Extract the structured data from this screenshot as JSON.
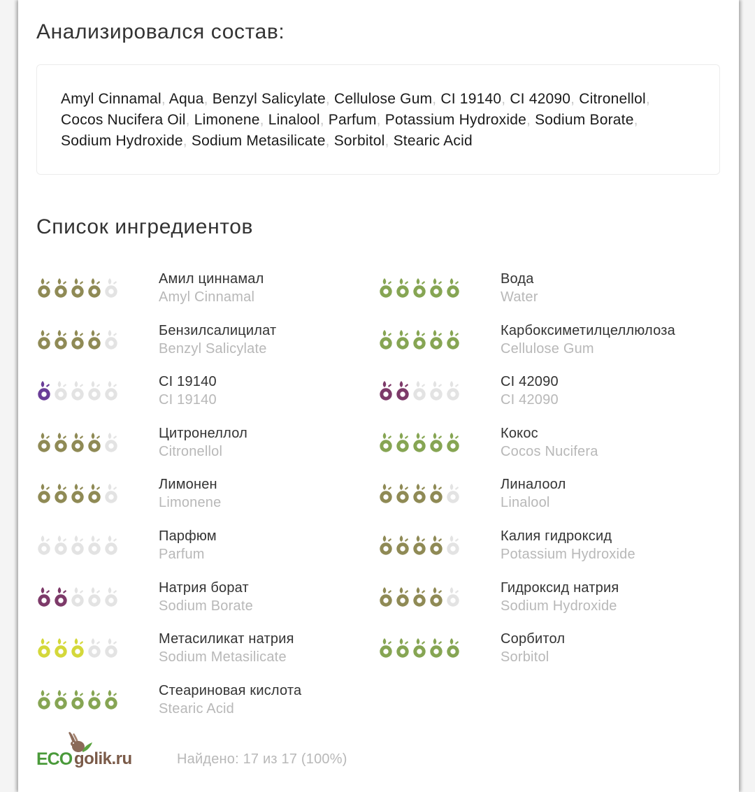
{
  "composition": {
    "title": "Анализировался состав:",
    "ingredients": [
      "Amyl Cinnamal",
      "Aqua",
      "Benzyl Salicylate",
      "Cellulose Gum",
      "CI 19140",
      "CI 42090",
      "Citronellol",
      "Cocos Nucifera Oil",
      "Limonene",
      "Linalool",
      "Parfum",
      "Potassium Hydroxide",
      "Sodium Borate",
      "Sodium Hydroxide",
      "Sodium Metasilicate",
      "Sorbitol",
      "Stearic Acid"
    ],
    "separator": ","
  },
  "ingredient_list": {
    "title": "Список ингредиентов",
    "colors": {
      "olive": "#8f8a55",
      "green": "#86a553",
      "purple": "#6a3d98",
      "plum": "#7d3a69",
      "yellow": "#d4d83a",
      "empty": "#e3e3e3"
    },
    "items": [
      {
        "name": "Амил циннамал",
        "latin": "Amyl Cinnamal",
        "rating": 4,
        "max": 5,
        "color": "olive"
      },
      {
        "name": "Вода",
        "latin": "Water",
        "rating": 5,
        "max": 5,
        "color": "green"
      },
      {
        "name": "Бензилсалицилат",
        "latin": "Benzyl Salicylate",
        "rating": 4,
        "max": 5,
        "color": "olive"
      },
      {
        "name": "Карбоксиметилцеллюлоза",
        "latin": "Cellulose Gum",
        "rating": 5,
        "max": 5,
        "color": "green"
      },
      {
        "name": "CI 19140",
        "latin": "CI 19140",
        "rating": 1,
        "max": 5,
        "color": "purple"
      },
      {
        "name": "CI 42090",
        "latin": "CI 42090",
        "rating": 2,
        "max": 5,
        "color": "plum"
      },
      {
        "name": "Цитронеллол",
        "latin": "Citronellol",
        "rating": 4,
        "max": 5,
        "color": "olive"
      },
      {
        "name": "Кокос",
        "latin": "Cocos Nucifera",
        "rating": 5,
        "max": 5,
        "color": "green"
      },
      {
        "name": "Лимонен",
        "latin": "Limonene",
        "rating": 4,
        "max": 5,
        "color": "olive"
      },
      {
        "name": "Линалоол",
        "latin": "Linalool",
        "rating": 4,
        "max": 5,
        "color": "olive"
      },
      {
        "name": "Парфюм",
        "latin": "Parfum",
        "rating": 0,
        "max": 5,
        "color": "olive"
      },
      {
        "name": "Калия гидроксид",
        "latin": "Potassium Hydroxide",
        "rating": 4,
        "max": 5,
        "color": "olive"
      },
      {
        "name": "Натрия борат",
        "latin": "Sodium Borate",
        "rating": 2,
        "max": 5,
        "color": "plum"
      },
      {
        "name": "Гидроксид натрия",
        "latin": "Sodium Hydroxide",
        "rating": 4,
        "max": 5,
        "color": "olive"
      },
      {
        "name": "Метасиликат натрия",
        "latin": "Sodium Metasilicate",
        "rating": 3,
        "max": 5,
        "color": "yellow"
      },
      {
        "name": "Сорбитол",
        "latin": "Sorbitol",
        "rating": 5,
        "max": 5,
        "color": "green"
      },
      {
        "name": "Стеариновая кислота",
        "latin": "Stearic Acid",
        "rating": 5,
        "max": 5,
        "color": "green"
      }
    ]
  },
  "footer": {
    "logo_eco": "ECO",
    "logo_golik": "golik.ru",
    "logo_icon": "rabbit-icon",
    "found_text": "Найдено: 17 из 17 (100%)",
    "found_count": 17,
    "total_count": 17,
    "found_percent": 100
  }
}
